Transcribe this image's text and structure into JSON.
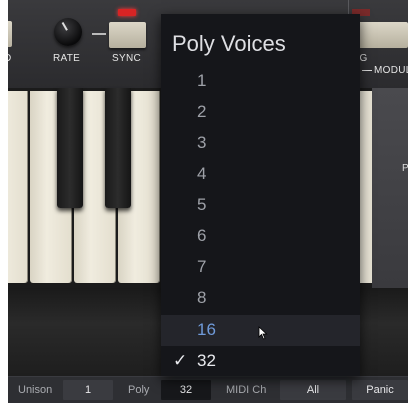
{
  "panel": {
    "left_label": "D",
    "rate_label": "RATE",
    "sync_label": "SYNC",
    "right_label_top": "NG",
    "right_label_modul": "MODUL",
    "right_side_label": "P"
  },
  "dropdown": {
    "title": "Poly Voices",
    "items": [
      {
        "label": "1"
      },
      {
        "label": "2"
      },
      {
        "label": "3"
      },
      {
        "label": "4"
      },
      {
        "label": "5"
      },
      {
        "label": "6"
      },
      {
        "label": "7"
      },
      {
        "label": "8"
      },
      {
        "label": "16",
        "state": "hovered"
      },
      {
        "label": "32",
        "state": "selected"
      }
    ],
    "check_glyph": "✓"
  },
  "statusbar": {
    "unison_label": "Unison",
    "unison_value": "1",
    "poly_label": "Poly",
    "poly_value": "32",
    "midi_label": "MIDI Ch",
    "midi_value": "All",
    "panic_label": "Panic"
  },
  "colors": {
    "menu_bg": "#15161a",
    "hover_bg": "#24252b",
    "hover_text": "#6f9ad9",
    "sync_led": "#d82424"
  }
}
